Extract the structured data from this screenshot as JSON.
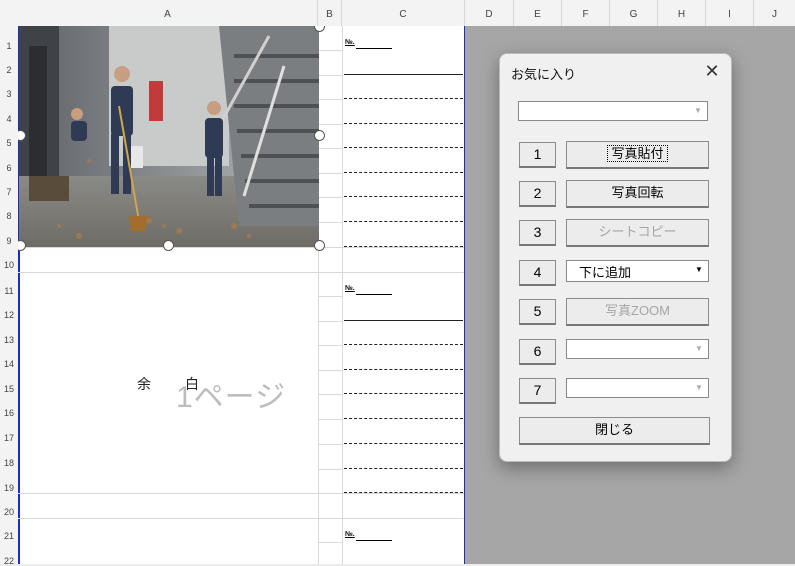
{
  "columns": [
    "A",
    "B",
    "C",
    "D",
    "E",
    "F",
    "G",
    "H",
    "I",
    "J"
  ],
  "rows": [
    "1",
    "2",
    "3",
    "4",
    "5",
    "6",
    "7",
    "8",
    "9",
    "10",
    "11",
    "12",
    "13",
    "14",
    "15",
    "16",
    "17",
    "18",
    "19",
    "20",
    "21",
    "22"
  ],
  "sheet": {
    "no_label": "№.",
    "blank_text_1": "余",
    "blank_text_2": "白",
    "page_text": "1ページ"
  },
  "dialog": {
    "title": "お気に入り",
    "close_icon": "close-icon",
    "top_select_value": "",
    "buttons": [
      {
        "num": "1",
        "label": "写真貼付",
        "enabled": true
      },
      {
        "num": "2",
        "label": "写真回転",
        "enabled": true
      },
      {
        "num": "3",
        "label": "シートコピー",
        "enabled": false
      },
      {
        "num": "4",
        "label": "下に追加",
        "enabled": true
      },
      {
        "num": "5",
        "label": "写真ZOOM",
        "enabled": false
      },
      {
        "num": "6",
        "label": "",
        "enabled": false
      },
      {
        "num": "7",
        "label": "",
        "enabled": false
      }
    ],
    "close_label": "閉じる"
  },
  "colors": {
    "sheet_border": "#1a2bd1",
    "outside_area": "#a6a6a6"
  }
}
